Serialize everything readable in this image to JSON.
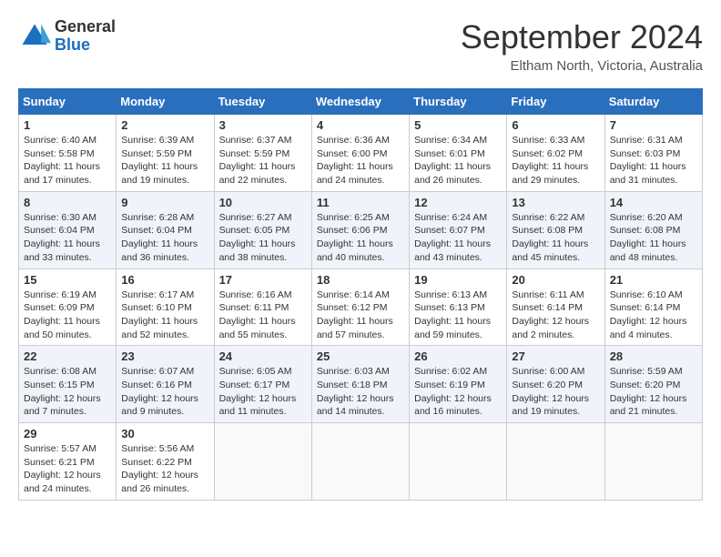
{
  "header": {
    "logo": {
      "general": "General",
      "blue": "Blue"
    },
    "title": "September 2024",
    "location": "Eltham North, Victoria, Australia"
  },
  "calendar": {
    "days_of_week": [
      "Sunday",
      "Monday",
      "Tuesday",
      "Wednesday",
      "Thursday",
      "Friday",
      "Saturday"
    ],
    "weeks": [
      [
        {
          "day": "1",
          "info": "Sunrise: 6:40 AM\nSunset: 5:58 PM\nDaylight: 11 hours\nand 17 minutes."
        },
        {
          "day": "2",
          "info": "Sunrise: 6:39 AM\nSunset: 5:59 PM\nDaylight: 11 hours\nand 19 minutes."
        },
        {
          "day": "3",
          "info": "Sunrise: 6:37 AM\nSunset: 5:59 PM\nDaylight: 11 hours\nand 22 minutes."
        },
        {
          "day": "4",
          "info": "Sunrise: 6:36 AM\nSunset: 6:00 PM\nDaylight: 11 hours\nand 24 minutes."
        },
        {
          "day": "5",
          "info": "Sunrise: 6:34 AM\nSunset: 6:01 PM\nDaylight: 11 hours\nand 26 minutes."
        },
        {
          "day": "6",
          "info": "Sunrise: 6:33 AM\nSunset: 6:02 PM\nDaylight: 11 hours\nand 29 minutes."
        },
        {
          "day": "7",
          "info": "Sunrise: 6:31 AM\nSunset: 6:03 PM\nDaylight: 11 hours\nand 31 minutes."
        }
      ],
      [
        {
          "day": "8",
          "info": "Sunrise: 6:30 AM\nSunset: 6:04 PM\nDaylight: 11 hours\nand 33 minutes."
        },
        {
          "day": "9",
          "info": "Sunrise: 6:28 AM\nSunset: 6:04 PM\nDaylight: 11 hours\nand 36 minutes."
        },
        {
          "day": "10",
          "info": "Sunrise: 6:27 AM\nSunset: 6:05 PM\nDaylight: 11 hours\nand 38 minutes."
        },
        {
          "day": "11",
          "info": "Sunrise: 6:25 AM\nSunset: 6:06 PM\nDaylight: 11 hours\nand 40 minutes."
        },
        {
          "day": "12",
          "info": "Sunrise: 6:24 AM\nSunset: 6:07 PM\nDaylight: 11 hours\nand 43 minutes."
        },
        {
          "day": "13",
          "info": "Sunrise: 6:22 AM\nSunset: 6:08 PM\nDaylight: 11 hours\nand 45 minutes."
        },
        {
          "day": "14",
          "info": "Sunrise: 6:20 AM\nSunset: 6:08 PM\nDaylight: 11 hours\nand 48 minutes."
        }
      ],
      [
        {
          "day": "15",
          "info": "Sunrise: 6:19 AM\nSunset: 6:09 PM\nDaylight: 11 hours\nand 50 minutes."
        },
        {
          "day": "16",
          "info": "Sunrise: 6:17 AM\nSunset: 6:10 PM\nDaylight: 11 hours\nand 52 minutes."
        },
        {
          "day": "17",
          "info": "Sunrise: 6:16 AM\nSunset: 6:11 PM\nDaylight: 11 hours\nand 55 minutes."
        },
        {
          "day": "18",
          "info": "Sunrise: 6:14 AM\nSunset: 6:12 PM\nDaylight: 11 hours\nand 57 minutes."
        },
        {
          "day": "19",
          "info": "Sunrise: 6:13 AM\nSunset: 6:13 PM\nDaylight: 11 hours\nand 59 minutes."
        },
        {
          "day": "20",
          "info": "Sunrise: 6:11 AM\nSunset: 6:14 PM\nDaylight: 12 hours\nand 2 minutes."
        },
        {
          "day": "21",
          "info": "Sunrise: 6:10 AM\nSunset: 6:14 PM\nDaylight: 12 hours\nand 4 minutes."
        }
      ],
      [
        {
          "day": "22",
          "info": "Sunrise: 6:08 AM\nSunset: 6:15 PM\nDaylight: 12 hours\nand 7 minutes."
        },
        {
          "day": "23",
          "info": "Sunrise: 6:07 AM\nSunset: 6:16 PM\nDaylight: 12 hours\nand 9 minutes."
        },
        {
          "day": "24",
          "info": "Sunrise: 6:05 AM\nSunset: 6:17 PM\nDaylight: 12 hours\nand 11 minutes."
        },
        {
          "day": "25",
          "info": "Sunrise: 6:03 AM\nSunset: 6:18 PM\nDaylight: 12 hours\nand 14 minutes."
        },
        {
          "day": "26",
          "info": "Sunrise: 6:02 AM\nSunset: 6:19 PM\nDaylight: 12 hours\nand 16 minutes."
        },
        {
          "day": "27",
          "info": "Sunrise: 6:00 AM\nSunset: 6:20 PM\nDaylight: 12 hours\nand 19 minutes."
        },
        {
          "day": "28",
          "info": "Sunrise: 5:59 AM\nSunset: 6:20 PM\nDaylight: 12 hours\nand 21 minutes."
        }
      ],
      [
        {
          "day": "29",
          "info": "Sunrise: 5:57 AM\nSunset: 6:21 PM\nDaylight: 12 hours\nand 24 minutes."
        },
        {
          "day": "30",
          "info": "Sunrise: 5:56 AM\nSunset: 6:22 PM\nDaylight: 12 hours\nand 26 minutes."
        },
        {
          "day": "",
          "info": ""
        },
        {
          "day": "",
          "info": ""
        },
        {
          "day": "",
          "info": ""
        },
        {
          "day": "",
          "info": ""
        },
        {
          "day": "",
          "info": ""
        }
      ]
    ]
  }
}
